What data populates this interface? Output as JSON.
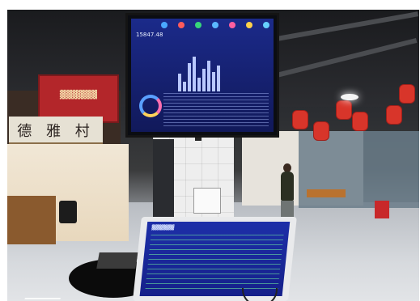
{
  "scene": {
    "shop_sign_text": "德 雅 村"
  },
  "big_screen": {
    "first_value": "15847.48",
    "bar_heights": [
      0.45,
      0.25,
      0.72,
      0.9,
      0.35,
      0.58,
      0.8,
      0.5,
      0.66
    ],
    "stat_colors": [
      "#4aa8ff",
      "#ff5b5b",
      "#37d67a",
      "#5bb9ff",
      "#ff5fa0",
      "#ffd24a",
      "#66d0ff"
    ]
  },
  "colors": {
    "screen_blue": "#1b2a8a",
    "lantern_red": "#d8352a",
    "shop_sign_bg": "#e6e1d4"
  }
}
